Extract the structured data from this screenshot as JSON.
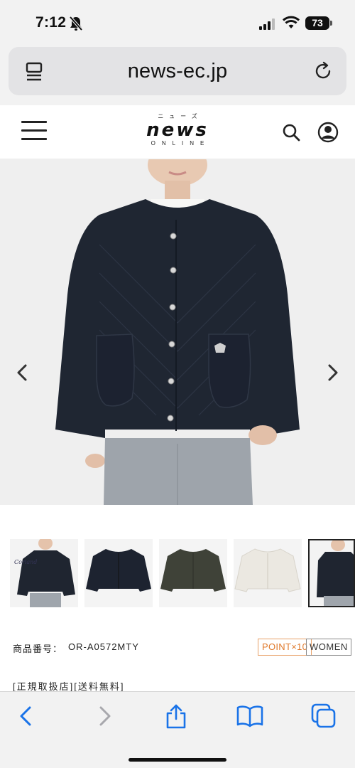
{
  "status_bar": {
    "time": "7:12",
    "battery": "73",
    "icons": [
      "bell-slash-icon",
      "cellular-signal-icon",
      "wifi-icon",
      "battery-icon"
    ]
  },
  "browser": {
    "url": "news-ec.jp",
    "left_icon": "reader-mode-icon",
    "right_icon": "reload-icon"
  },
  "site_header": {
    "logo_kana": "ニューズ",
    "logo_main": "news",
    "logo_sub": "ONLINE",
    "icons": [
      "hamburger-menu-icon",
      "search-icon",
      "account-icon"
    ]
  },
  "product": {
    "code_label": "商品番号：",
    "code_value": "OR-A0572MTY",
    "point_badge": "POINT×10",
    "category_badge": "WOMEN",
    "shop_tags": "[正規取扱店][送料無料]",
    "thumbnails": [
      {
        "color": "#1f2530",
        "caption": "Coriand"
      },
      {
        "color": "#1d2330",
        "caption": ""
      },
      {
        "color": "#3f4238",
        "caption": ""
      },
      {
        "color": "#ebe8e1",
        "caption": ""
      },
      {
        "color": "#1f2530",
        "caption": ""
      }
    ],
    "active_thumbnail": 4
  },
  "toolbar": {
    "icons": [
      "back-icon",
      "forward-icon",
      "share-icon",
      "bookmarks-icon",
      "tabs-icon"
    ]
  },
  "colors": {
    "jacket": "#1f2632",
    "accent_orange": "#e07a2c",
    "ios_blue": "#1a73e8"
  }
}
